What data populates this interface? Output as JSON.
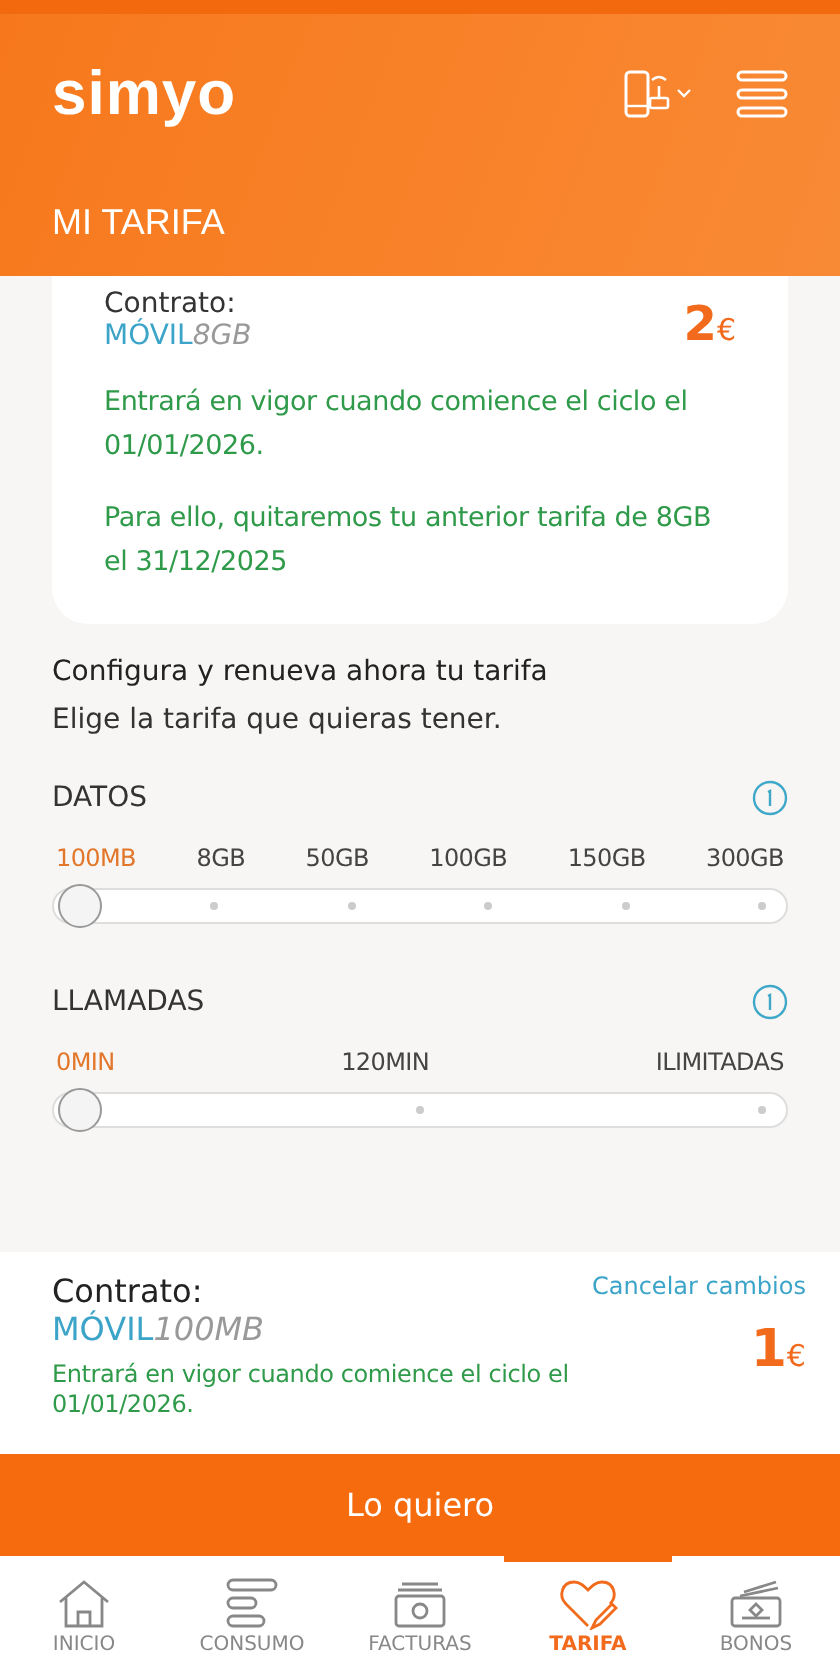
{
  "header": {
    "logo": "simyo",
    "title": "MI TARIFA"
  },
  "current_contract": {
    "label": "Contrato:",
    "plan": "MÓVIL",
    "plan_detail": "8GB",
    "price": "2",
    "currency": "€",
    "notes": [
      "Entrará en vigor cuando comience el ciclo el 01/01/2026.",
      "Para ello, quitaremos tu anterior tarifa de 8GB el 31/12/2025"
    ]
  },
  "configure": {
    "title": "Configura y renueva ahora tu tarifa",
    "subtitle": "Elige la tarifa que quieras tener."
  },
  "sliders": [
    {
      "title": "DATOS",
      "options": [
        {
          "label": "100MB",
          "selected": true
        },
        {
          "label": "8GB",
          "selected": false
        },
        {
          "label": "50GB",
          "selected": false
        },
        {
          "label": "100GB",
          "selected": false
        },
        {
          "label": "150GB",
          "selected": false
        },
        {
          "label": "300GB",
          "selected": false
        }
      ]
    },
    {
      "title": "LLAMADAS",
      "options": [
        {
          "label": "0MIN",
          "selected": true
        },
        {
          "label": "120MIN",
          "selected": false
        },
        {
          "label": "ILIMITADAS",
          "selected": false
        }
      ]
    }
  ],
  "new_contract": {
    "label": "Contrato:",
    "plan": "MÓVIL",
    "plan_detail": "100MB",
    "cancel": "Cancelar cambios",
    "price": "1",
    "currency": "€",
    "note": "Entrará en vigor cuando comience el ciclo el 01/01/2026."
  },
  "cta": "Lo quiero",
  "nav": [
    {
      "label": "INICIO",
      "kind": "home",
      "selected": false
    },
    {
      "label": "CONSUMO",
      "kind": "usage",
      "selected": false
    },
    {
      "label": "FACTURAS",
      "kind": "bills",
      "selected": false
    },
    {
      "label": "TARIFA",
      "kind": "tariff",
      "selected": true
    },
    {
      "label": "BONOS",
      "kind": "bonus",
      "selected": false
    }
  ]
}
